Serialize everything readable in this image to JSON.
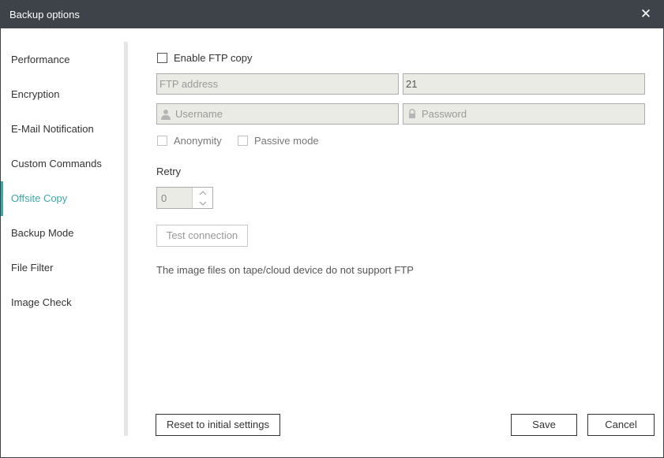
{
  "window": {
    "title": "Backup options",
    "close_label": "✕"
  },
  "sidebar": {
    "items": [
      {
        "label": "Performance",
        "active": false
      },
      {
        "label": "Encryption",
        "active": false
      },
      {
        "label": "E-Mail Notification",
        "active": false
      },
      {
        "label": "Custom Commands",
        "active": false
      },
      {
        "label": "Offsite Copy",
        "active": true
      },
      {
        "label": "Backup Mode",
        "active": false
      },
      {
        "label": "File Filter",
        "active": false
      },
      {
        "label": "Image Check",
        "active": false
      }
    ]
  },
  "ftp": {
    "enable_label": "Enable FTP copy",
    "enabled": false,
    "address_placeholder": "FTP address",
    "port_value": "21",
    "username_placeholder": "Username",
    "password_placeholder": "Password",
    "anonymity_label": "Anonymity",
    "passive_label": "Passive mode",
    "retry_label": "Retry",
    "retry_value": "0",
    "test_button": "Test connection",
    "note": "The image files on tape/cloud device do not support FTP"
  },
  "footer": {
    "reset_button": "Reset to initial settings",
    "save_button": "Save",
    "cancel_button": "Cancel"
  },
  "colors": {
    "titlebar": "#3e434a",
    "accent": "#3ea6a7",
    "field_bg": "#ebebe5"
  },
  "icons": {
    "close": "close-icon",
    "user": "user-icon",
    "lock": "lock-icon"
  }
}
